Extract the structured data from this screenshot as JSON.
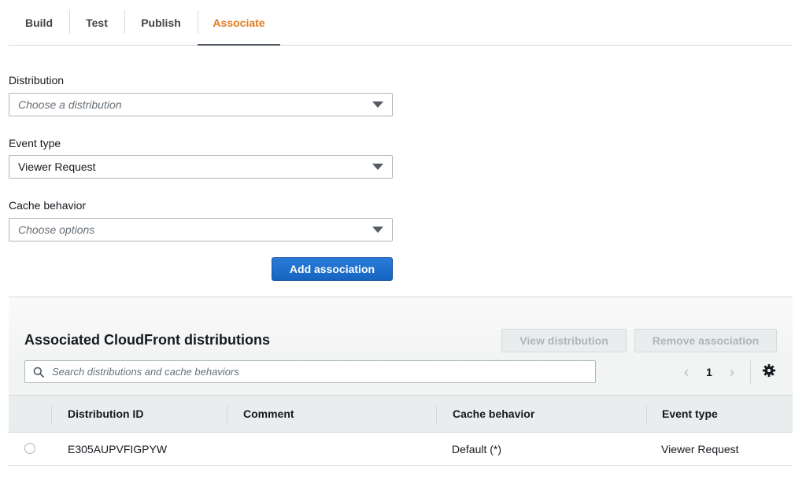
{
  "tabs": [
    {
      "label": "Build",
      "active": false
    },
    {
      "label": "Test",
      "active": false
    },
    {
      "label": "Publish",
      "active": false
    },
    {
      "label": "Associate",
      "active": true
    }
  ],
  "form": {
    "distribution": {
      "label": "Distribution",
      "placeholder": "Choose a distribution"
    },
    "event_type": {
      "label": "Event type",
      "value": "Viewer Request"
    },
    "cache_behavior": {
      "label": "Cache behavior",
      "placeholder": "Choose options"
    },
    "add_button": "Add association"
  },
  "associated": {
    "title": "Associated CloudFront distributions",
    "view_button": "View distribution",
    "remove_button": "Remove association",
    "search_placeholder": "Search distributions and cache behaviors",
    "page": "1",
    "columns": [
      "Distribution ID",
      "Comment",
      "Cache behavior",
      "Event type"
    ],
    "rows": [
      {
        "distribution_id": "E305AUPVFIGPYW",
        "comment": "",
        "cache_behavior": "Default (*)",
        "event_type": "Viewer Request"
      }
    ]
  },
  "colors": {
    "active_tab": "#e07b20",
    "primary_button": "#1d6fcb",
    "disabled_text": "#aab7b8"
  },
  "icons": {
    "select_caret": "caret-down-icon",
    "search": "search-icon",
    "pager_prev": "chevron-left-icon",
    "pager_next": "chevron-right-icon",
    "settings": "gear-icon"
  }
}
